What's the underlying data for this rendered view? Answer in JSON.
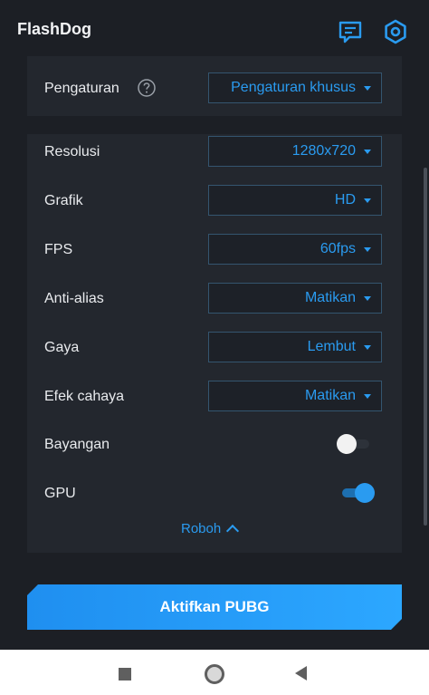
{
  "app": {
    "title": "FlashDog"
  },
  "settings": {
    "mode_label": "Pengaturan",
    "mode_value": "Pengaturan khusus",
    "rows": [
      {
        "label": "Resolusi",
        "value": "1280x720"
      },
      {
        "label": "Grafik",
        "value": "HD"
      },
      {
        "label": "FPS",
        "value": "60fps"
      },
      {
        "label": "Anti-alias",
        "value": "Matikan"
      },
      {
        "label": "Gaya",
        "value": "Lembut"
      },
      {
        "label": "Efek cahaya",
        "value": "Matikan"
      }
    ],
    "toggles": [
      {
        "label": "Bayangan",
        "on": false
      },
      {
        "label": "GPU",
        "on": true
      }
    ],
    "collapse_label": "Roboh"
  },
  "action": {
    "activate_label": "Aktifkan PUBG"
  },
  "colors": {
    "accent": "#2a9bf0",
    "background": "#1c1f25",
    "panel": "#23272e"
  },
  "icons": [
    "feedback-icon",
    "settings-hex-icon",
    "help-icon",
    "chevron-down-icon",
    "chevron-up-icon"
  ]
}
